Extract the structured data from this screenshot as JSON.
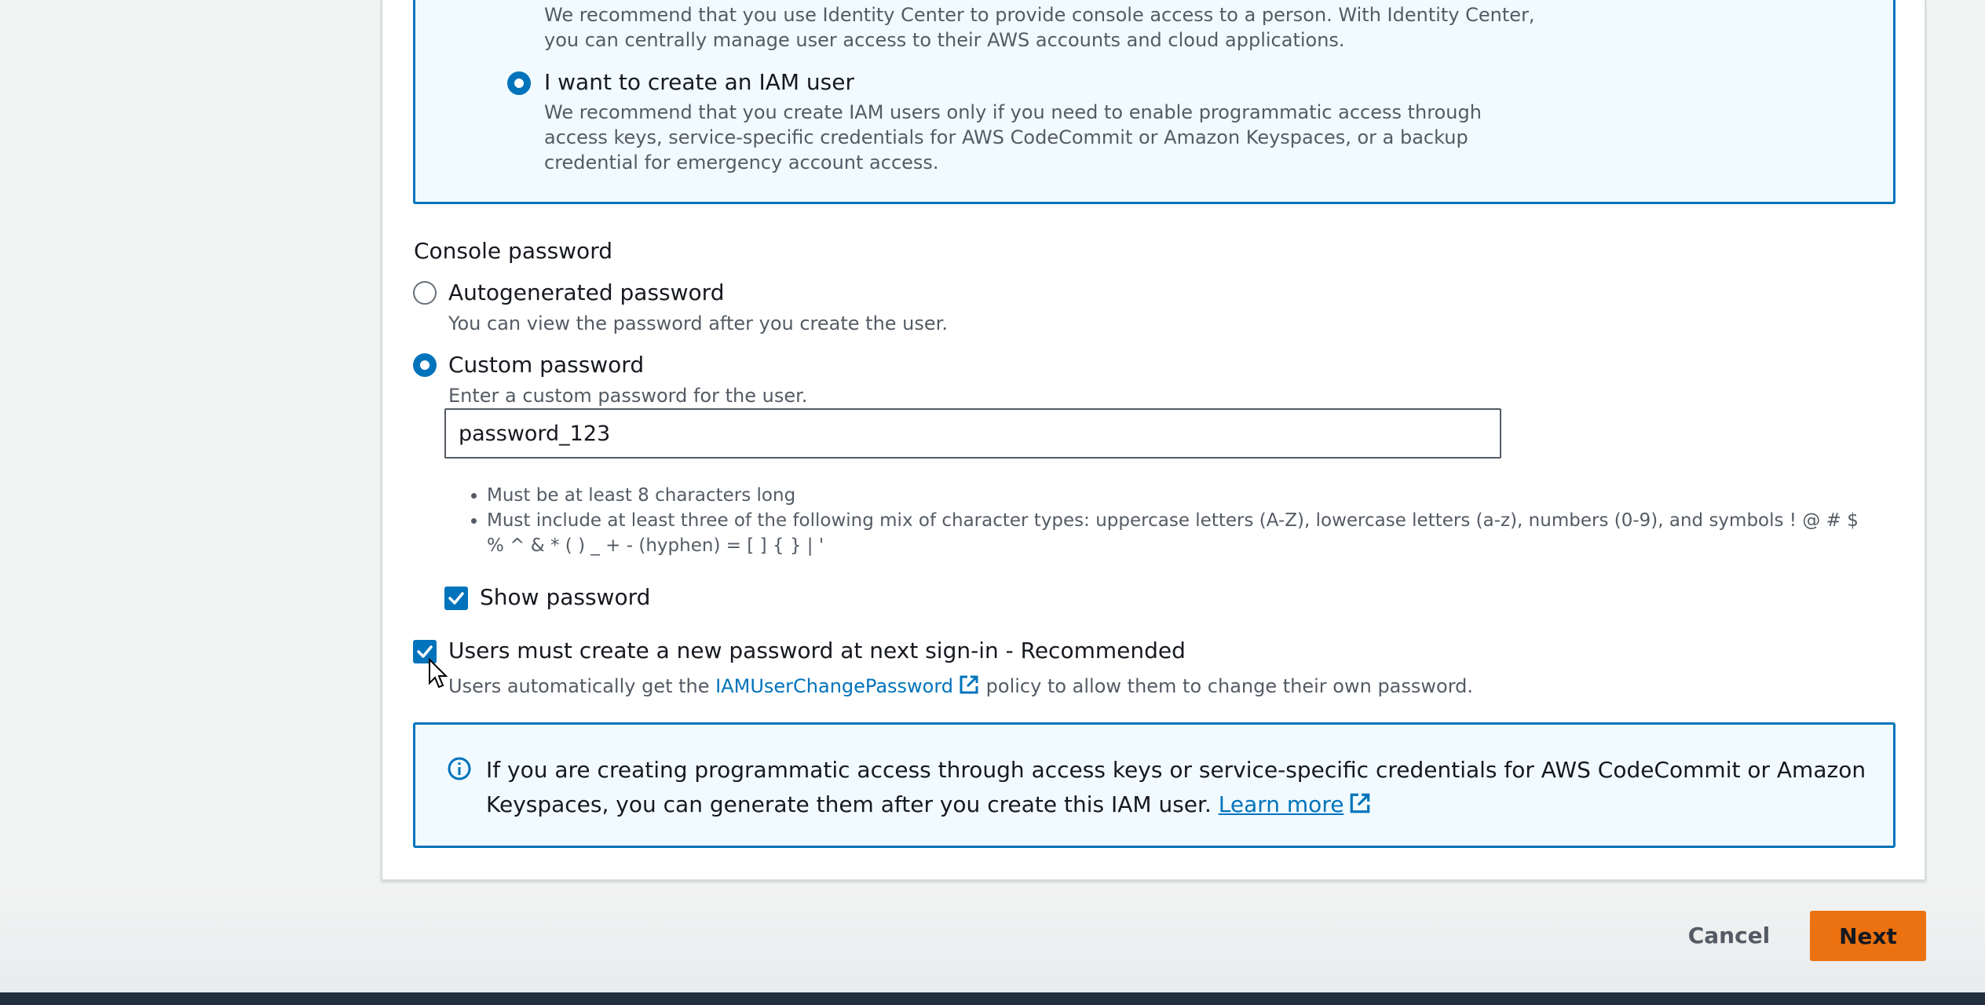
{
  "access_options": {
    "identity_center_desc": "We recommend that you use Identity Center to provide console access to a person. With Identity Center, you can centrally manage user access to their AWS accounts and cloud applications.",
    "iam_user_label": "I want to create an IAM user",
    "iam_user_desc": "We recommend that you create IAM users only if you need to enable programmatic access through access keys, service-specific credentials for AWS CodeCommit or Amazon Keyspaces, or a backup credential for emergency account access.",
    "iam_user_selected": true
  },
  "console_password": {
    "title": "Console password",
    "autogenerated_label": "Autogenerated password",
    "autogenerated_desc": "You can view the password after you create the user.",
    "custom_label": "Custom password",
    "custom_desc": "Enter a custom password for the user.",
    "selected": "custom",
    "password_value": "password_123",
    "rules": [
      "Must be at least 8 characters long",
      "Must include at least three of the following mix of character types: uppercase letters (A-Z), lowercase letters (a-z), numbers (0-9), and symbols ! @ # $ % ^ & * ( ) _ + - (hyphen) = [ ] { } | '"
    ],
    "show_password_label": "Show password",
    "show_password_checked": true
  },
  "reset_password": {
    "label": "Users must create a new password at next sign-in - Recommended",
    "checked": true,
    "desc_prefix": "Users automatically get the ",
    "policy_link": "IAMUserChangePassword",
    "desc_suffix": " policy to allow them to change their own password."
  },
  "info_alert": {
    "text": "If you are creating programmatic access through access keys or service-specific credentials for AWS CodeCommit or Amazon Keyspaces, you can generate them after you create this IAM user. ",
    "link": "Learn more"
  },
  "footer": {
    "cancel_label": "Cancel",
    "next_label": "Next"
  },
  "colors": {
    "accent": "#0073bb",
    "primary_button": "#ec7211",
    "info_bg": "#f1faff"
  }
}
